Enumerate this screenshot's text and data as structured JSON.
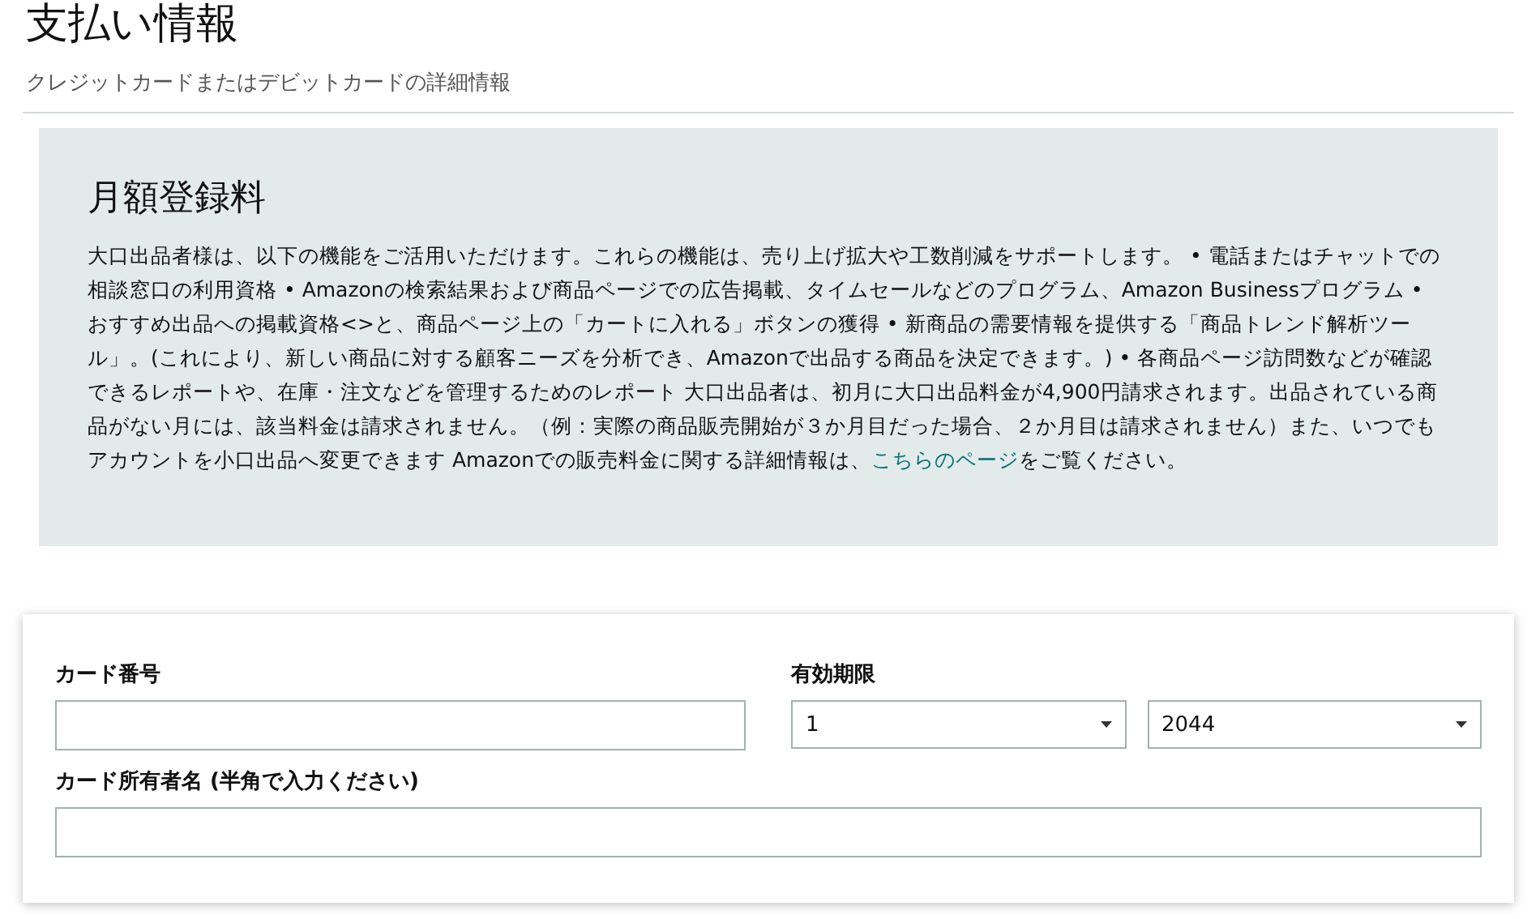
{
  "page": {
    "title": "支払い情報",
    "subtitle": "クレジットカードまたはデビットカードの詳細情報"
  },
  "fee_panel": {
    "heading": "月額登録料",
    "body_before": "大口出品者様は、以下の機能をご活用いただけます。これらの機能は、売り上げ拡大や工数削減をサポートします。 • 電話またはチャットでの相談窓口の利用資格 • Amazonの検索結果および商品ページでの広告掲載、タイムセールなどのプログラム、Amazon Businessプログラム • おすすめ出品への掲載資格<>と、商品ページ上の「カートに入れる」ボタンの獲得 • 新商品の需要情報を提供する「商品トレンド解析ツール」。(これにより、新しい商品に対する顧客ニーズを分析でき、Amazonで出品する商品を決定できます。) • 各商品ページ訪問数などが確認できるレポートや、在庫・注文などを管理するためのレポート 大口出品者は、初月に大口出品料金が4,900円請求されます。出品されている商品がない月には、該当料金は請求されません。（例：実際の商品販売開始が３か月目だった場合、２か月目は請求されません）また、いつでもアカウントを小口出品へ変更できます Amazonでの販売料金に関する詳細情報は、",
    "link": "こちらのページ",
    "body_after": "をご覧ください。"
  },
  "card_form": {
    "card_number": {
      "label": "カード番号"
    },
    "expiry": {
      "label": "有効期限",
      "month": "1",
      "year": "2044"
    },
    "holder_name": {
      "label": "カード所有者名 (半角で入力ください)"
    }
  }
}
